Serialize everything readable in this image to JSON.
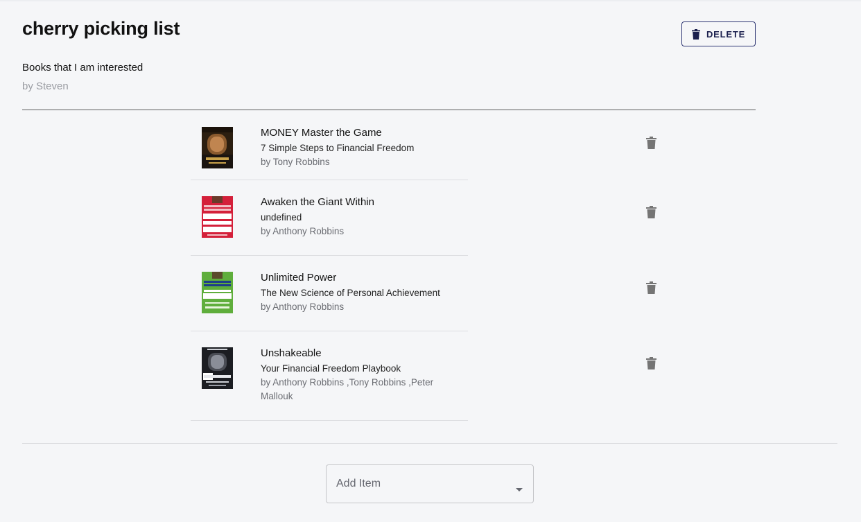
{
  "list": {
    "title": "cherry picking list",
    "description": "Books that I am interested",
    "author": "by Steven",
    "delete_label": "DELETE"
  },
  "books": [
    {
      "title": "MONEY Master the Game",
      "subtitle": "7 Simple Steps to Financial Freedom",
      "authors": "by Tony Robbins",
      "cover_color": "#2b1e10"
    },
    {
      "title": "Awaken the Giant Within",
      "subtitle": "undefined",
      "authors": "by Anthony Robbins",
      "cover_color": "#d4203a"
    },
    {
      "title": "Unlimited Power",
      "subtitle": "The New Science of Personal Achievement",
      "authors": "by Anthony Robbins",
      "cover_color": "#5fae3c"
    },
    {
      "title": "Unshakeable",
      "subtitle": "Your Financial Freedom Playbook",
      "authors": "by Anthony Robbins ,Tony Robbins ,Peter Mallouk",
      "cover_color": "#1b1d22"
    }
  ],
  "add_item": {
    "placeholder": "Add Item"
  },
  "icons": {
    "delete": "trash-icon",
    "dropdown": "caret-down-icon"
  },
  "colors": {
    "background": "#f5f6f8",
    "delete_button_border": "#2a3270",
    "trash_icon": "#757575"
  }
}
